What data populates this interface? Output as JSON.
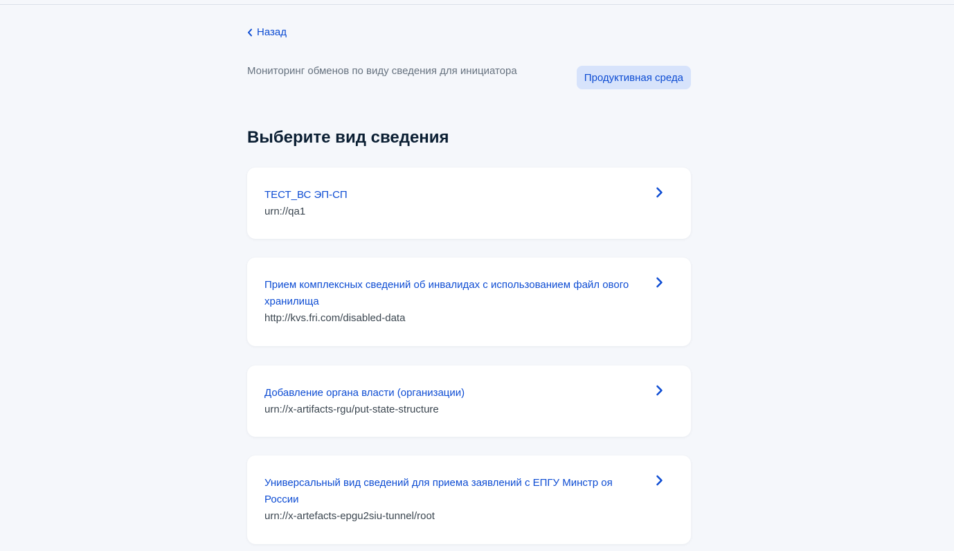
{
  "nav": {
    "back_label": "Назад"
  },
  "header": {
    "service_title": "Мониторинг обменов по виду сведения для инициатора",
    "environment_badge": "Продуктивная среда"
  },
  "page": {
    "heading": "Выберите вид сведения"
  },
  "items": [
    {
      "title": "ТЕСТ_ВС ЭП-СП",
      "urn": "urn://qa1"
    },
    {
      "title": "Прием комплексных сведений об инвалидах с использованием файл ового хранилища",
      "urn": "http://kvs.fri.com/disabled-data"
    },
    {
      "title": "Добавление органа власти (организации)",
      "urn": "urn://x-artifacts-rgu/put-state-structure"
    },
    {
      "title": "Универсальный вид сведений для приема заявлений с ЕПГУ Минстр оя России",
      "urn": "urn://x-artefacts-epgu2siu-tunnel/root"
    }
  ],
  "icons": {
    "back": "chevron-left-icon",
    "item_arrow": "chevron-right-icon"
  },
  "colors": {
    "accent": "#0d4cd3",
    "background": "#f5f7fb",
    "badge_background": "#d7e3fb",
    "muted_text": "#66727f",
    "card_background": "#ffffff"
  }
}
